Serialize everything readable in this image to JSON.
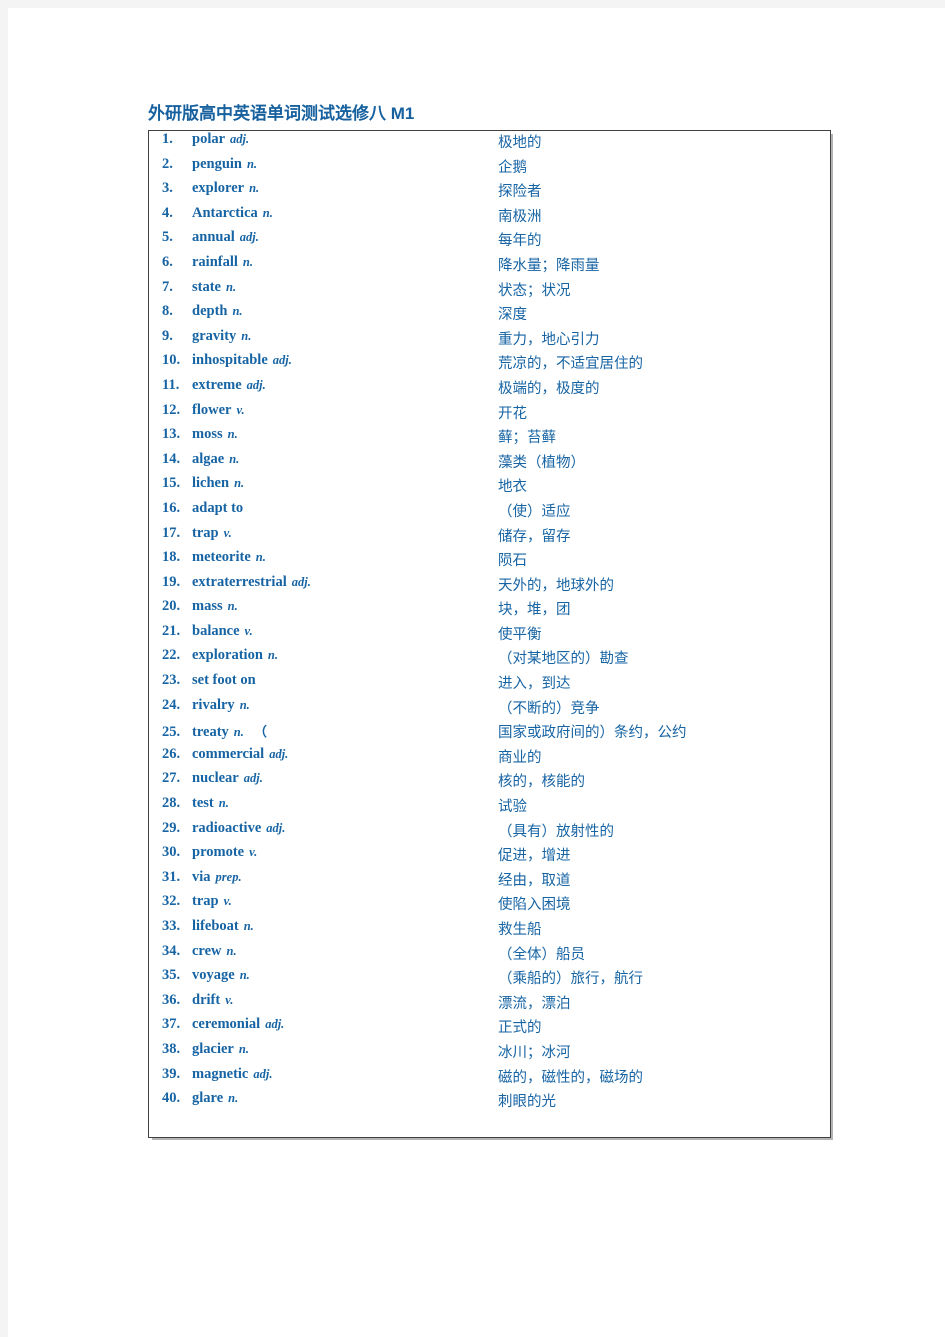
{
  "document": {
    "title": "外研版高中英语单词测试选修八 M1",
    "accent_color": "#1764a4",
    "page_background": "#ffffff",
    "canvas_background": "#f4f4f4",
    "table_border_color": "#404040"
  },
  "table": {
    "rows": [
      {
        "num": "1.",
        "word": "polar",
        "pos": "adj.",
        "extra": "",
        "meaning": "极地的"
      },
      {
        "num": "2.",
        "word": "penguin",
        "pos": "n.",
        "extra": "",
        "meaning": "企鹅"
      },
      {
        "num": "3.",
        "word": "explorer",
        "pos": "n.",
        "extra": "",
        "meaning": "探险者"
      },
      {
        "num": "4.",
        "word": "Antarctica",
        "pos": "n.",
        "extra": "",
        "meaning": "南极洲"
      },
      {
        "num": "5.",
        "word": "annual",
        "pos": "adj.",
        "extra": "",
        "meaning": "每年的"
      },
      {
        "num": "6.",
        "word": "rainfall",
        "pos": "n.",
        "extra": "",
        "meaning": "降水量；降雨量"
      },
      {
        "num": "7.",
        "word": "state",
        "pos": "n.",
        "extra": "",
        "meaning": "状态；状况"
      },
      {
        "num": "8.",
        "word": "depth",
        "pos": "n.",
        "extra": "",
        "meaning": "深度"
      },
      {
        "num": "9.",
        "word": "gravity",
        "pos": "n.",
        "extra": "",
        "meaning": "重力，地心引力"
      },
      {
        "num": "10.",
        "word": "inhospitable",
        "pos": "adj.",
        "extra": "",
        "meaning": "荒凉的，不适宜居住的"
      },
      {
        "num": "11.",
        "word": "extreme",
        "pos": "adj.",
        "extra": "",
        "meaning": "极端的，极度的"
      },
      {
        "num": "12.",
        "word": "flower",
        "pos": "v.",
        "extra": "",
        "meaning": "开花"
      },
      {
        "num": "13.",
        "word": "moss",
        "pos": "n.",
        "extra": "",
        "meaning": "藓；苔藓"
      },
      {
        "num": "14.",
        "word": "algae",
        "pos": "n.",
        "extra": "",
        "meaning": "藻类（植物）"
      },
      {
        "num": "15.",
        "word": "lichen",
        "pos": "n.",
        "extra": "",
        "meaning": "地衣"
      },
      {
        "num": "16.",
        "word": "adapt  to",
        "pos": "",
        "extra": "",
        "meaning": "（使）适应"
      },
      {
        "num": "17.",
        "word": "trap",
        "pos": "v.",
        "extra": "",
        "meaning": "储存，留存"
      },
      {
        "num": "18.",
        "word": "meteorite",
        "pos": "n.",
        "extra": "",
        "meaning": "陨石"
      },
      {
        "num": "19.",
        "word": "extraterrestrial",
        "pos": "adj.",
        "extra": "",
        "meaning": "天外的，地球外的"
      },
      {
        "num": "20.",
        "word": "mass",
        "pos": "n.",
        "extra": "",
        "meaning": "块，堆，团"
      },
      {
        "num": "21.",
        "word": "balance",
        "pos": "v.",
        "extra": "",
        "meaning": "使平衡"
      },
      {
        "num": "22.",
        "word": "exploration",
        "pos": "n.",
        "extra": "",
        "meaning": "（对某地区的）勘查"
      },
      {
        "num": "23.",
        "word": "set  foot  on",
        "pos": "",
        "extra": "",
        "meaning": "进入，到达"
      },
      {
        "num": "24.",
        "word": "rivalry",
        "pos": "n.",
        "extra": "",
        "meaning": "（不断的）竞争"
      },
      {
        "num": "25.",
        "word": "treaty",
        "pos": "n.",
        "extra": "（",
        "meaning": "国家或政府间的）条约，公约"
      },
      {
        "num": "26.",
        "word": "commercial",
        "pos": "adj.",
        "extra": "",
        "meaning": "商业的"
      },
      {
        "num": "27.",
        "word": "nuclear",
        "pos": "adj.",
        "extra": "",
        "meaning": "核的，核能的"
      },
      {
        "num": "28.",
        "word": "test",
        "pos": "n.",
        "extra": "",
        "meaning": "试验"
      },
      {
        "num": "29.",
        "word": "radioactive",
        "pos": "adj.",
        "extra": "",
        "meaning": "（具有）放射性的"
      },
      {
        "num": "30.",
        "word": "promote",
        "pos": "v.",
        "extra": "",
        "meaning": "促进，增进"
      },
      {
        "num": "31.",
        "word": "via",
        "pos": "prep.",
        "extra": "",
        "meaning": "经由，取道"
      },
      {
        "num": "32.",
        "word": "trap",
        "pos": "v.",
        "extra": "",
        "meaning": "使陷入困境"
      },
      {
        "num": "33.",
        "word": "lifeboat",
        "pos": "n.",
        "extra": "",
        "meaning": "救生船"
      },
      {
        "num": "34.",
        "word": "crew",
        "pos": "n.",
        "extra": "",
        "meaning": "（全体）船员"
      },
      {
        "num": "35.",
        "word": "voyage",
        "pos": "n.",
        "extra": "",
        "meaning": "（乘船的）旅行，航行"
      },
      {
        "num": "36.",
        "word": "drift",
        "pos": "v.",
        "extra": "",
        "meaning": "漂流，漂泊"
      },
      {
        "num": "37.",
        "word": "ceremonial",
        "pos": "adj.",
        "extra": "",
        "meaning": "正式的"
      },
      {
        "num": "38.",
        "word": "glacier",
        "pos": "n.",
        "extra": "",
        "meaning": "冰川；冰河"
      },
      {
        "num": "39.",
        "word": "magnetic",
        "pos": "adj.",
        "extra": "",
        "meaning": "磁的，磁性的，磁场的"
      },
      {
        "num": "40.",
        "word": "glare",
        "pos": "n.",
        "extra": "",
        "meaning": "刺眼的光"
      }
    ]
  }
}
